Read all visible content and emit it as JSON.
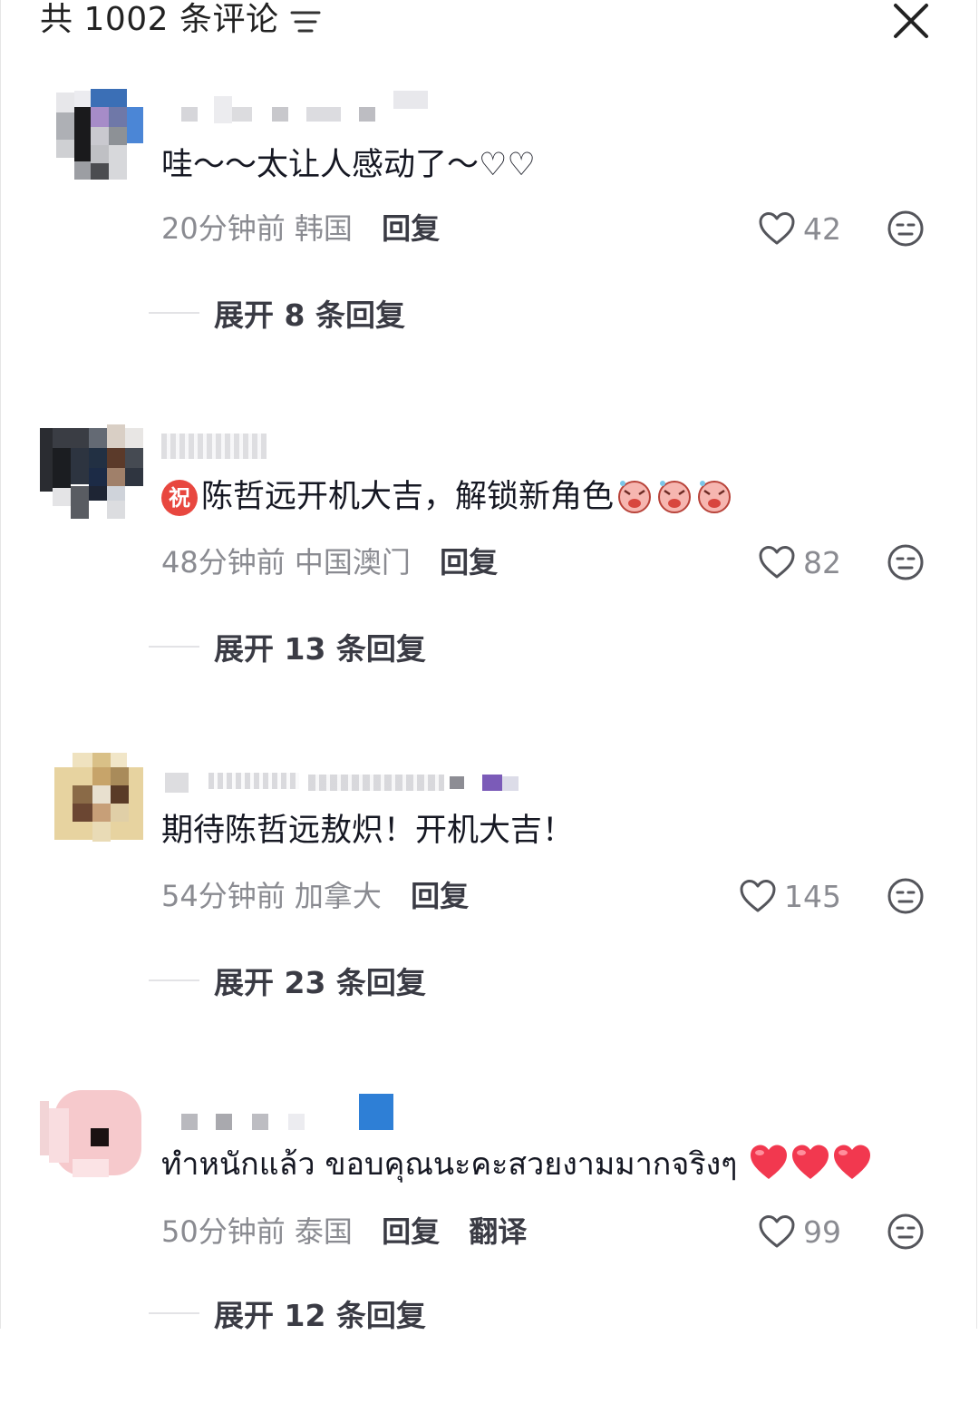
{
  "header": {
    "title": "共 1002 条评论",
    "filter_icon": "filter-sort-icon",
    "close_icon": "close-icon"
  },
  "comments": [
    {
      "username": "",
      "text": "哇～～太让人感动了～♡♡",
      "time": "20分钟前",
      "location": "韩国",
      "reply_label": "回复",
      "likes": "42",
      "expand_label": "展开 8 条回复"
    },
    {
      "username": "",
      "badge": "祝",
      "text": "陈哲远开机大吉，解锁新角色",
      "time": "48分钟前",
      "location": "中国澳门",
      "reply_label": "回复",
      "likes": "82",
      "expand_label": "展开 13 条回复"
    },
    {
      "username": "",
      "text": "期待陈哲远敖炽！开机大吉！",
      "time": "54分钟前",
      "location": "加拿大",
      "reply_label": "回复",
      "likes": "145",
      "expand_label": "展开 23 条回复"
    },
    {
      "username": "",
      "text": "ทำหนักแล้ว ขอบคุณนะคะสวยงามมากจริงๆ",
      "time": "50分钟前",
      "location": "泰国",
      "reply_label": "回复",
      "translate_label": "翻译",
      "likes": "99",
      "expand_label": "展开 12 条回复"
    }
  ],
  "colors": {
    "text_primary": "#161823",
    "text_secondary": "#8a8b91",
    "badge_red": "#e8473f",
    "heart_red": "#f2384f"
  }
}
